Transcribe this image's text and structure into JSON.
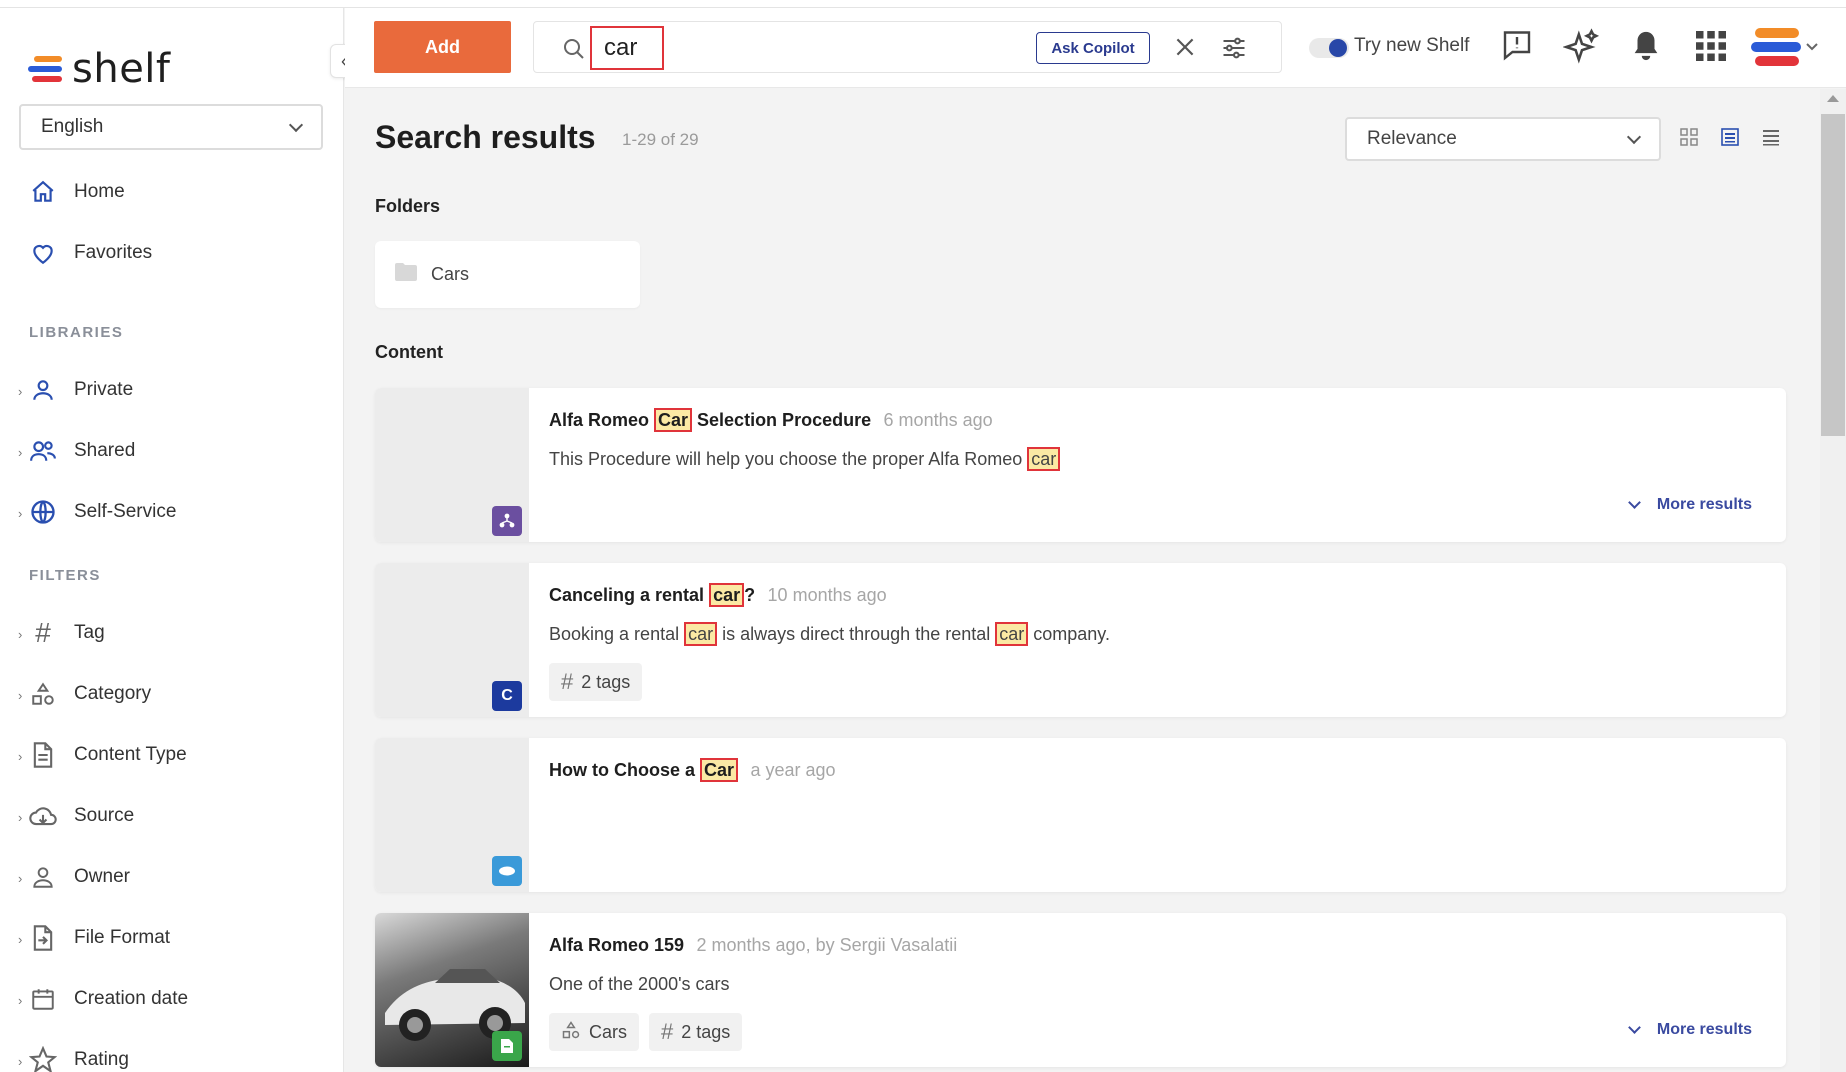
{
  "app": {
    "logo_text": "shelf"
  },
  "sidebar": {
    "language": "English",
    "nav": [
      {
        "label": "Home",
        "icon": "home-icon"
      },
      {
        "label": "Favorites",
        "icon": "heart-icon"
      }
    ],
    "libraries_label": "LIBRARIES",
    "libraries": [
      {
        "label": "Private",
        "icon": "user-icon"
      },
      {
        "label": "Shared",
        "icon": "users-icon"
      },
      {
        "label": "Self-Service",
        "icon": "globe-icon"
      }
    ],
    "filters_label": "FILTERS",
    "filters": [
      {
        "label": "Tag",
        "icon": "hash-icon"
      },
      {
        "label": "Category",
        "icon": "category-icon"
      },
      {
        "label": "Content Type",
        "icon": "document-icon"
      },
      {
        "label": "Source",
        "icon": "cloud-download-icon"
      },
      {
        "label": "Owner",
        "icon": "user-icon"
      },
      {
        "label": "File Format",
        "icon": "file-import-icon"
      },
      {
        "label": "Creation date",
        "icon": "calendar-icon"
      },
      {
        "label": "Rating",
        "icon": "star-icon"
      }
    ]
  },
  "topbar": {
    "add_label": "Add",
    "search_value": "car",
    "ask_copilot_label": "Ask Copilot",
    "try_new_label": "Try new Shelf"
  },
  "main": {
    "title": "Search results",
    "count": "1-29 of 29",
    "sort_value": "Relevance",
    "folders_label": "Folders",
    "folders": [
      {
        "label": "Cars"
      }
    ],
    "content_label": "Content",
    "results": [
      {
        "title_pre": "Alfa Romeo ",
        "title_hl": "Car",
        "title_post": " Selection Procedure",
        "meta": "6 months ago",
        "desc_parts": [
          {
            "t": "This Procedure will help you choose the proper Alfa Romeo "
          },
          {
            "h": "car"
          }
        ],
        "chips": [],
        "more": "More results",
        "badge_color": "#6b4fa0",
        "badge_icon": "hierarchy-icon"
      },
      {
        "title_pre": "Canceling a rental ",
        "title_hl": "car",
        "title_post": "?",
        "meta": "10 months ago",
        "desc_parts": [
          {
            "t": "Booking a rental "
          },
          {
            "h": "car"
          },
          {
            "t": " is always direct through the rental "
          },
          {
            "h": "car"
          },
          {
            "t": " company."
          }
        ],
        "chips": [
          {
            "label": "2 tags",
            "icon": "hash-icon"
          }
        ],
        "more": "",
        "badge_color": "#1c3a9e",
        "badge_icon": "c-logo-icon"
      },
      {
        "title_pre": "How to Choose a ",
        "title_hl": "Car",
        "title_post": "",
        "meta": "a year ago",
        "desc_parts": [],
        "chips": [],
        "more": "",
        "badge_color": "#3a9ad9",
        "badge_icon": "salesforce-icon"
      },
      {
        "title_pre": "Alfa Romeo 159",
        "title_hl": "",
        "title_post": "",
        "meta": "2 months ago, by Sergii Vasalatii",
        "desc_parts": [
          {
            "t": "One of the 2000's cars"
          }
        ],
        "chips": [
          {
            "label": "Cars",
            "icon": "category-icon"
          },
          {
            "label": "2 tags",
            "icon": "hash-icon"
          }
        ],
        "more": "More results",
        "badge_color": "#3aa64a",
        "badge_icon": "doc-icon"
      }
    ]
  }
}
